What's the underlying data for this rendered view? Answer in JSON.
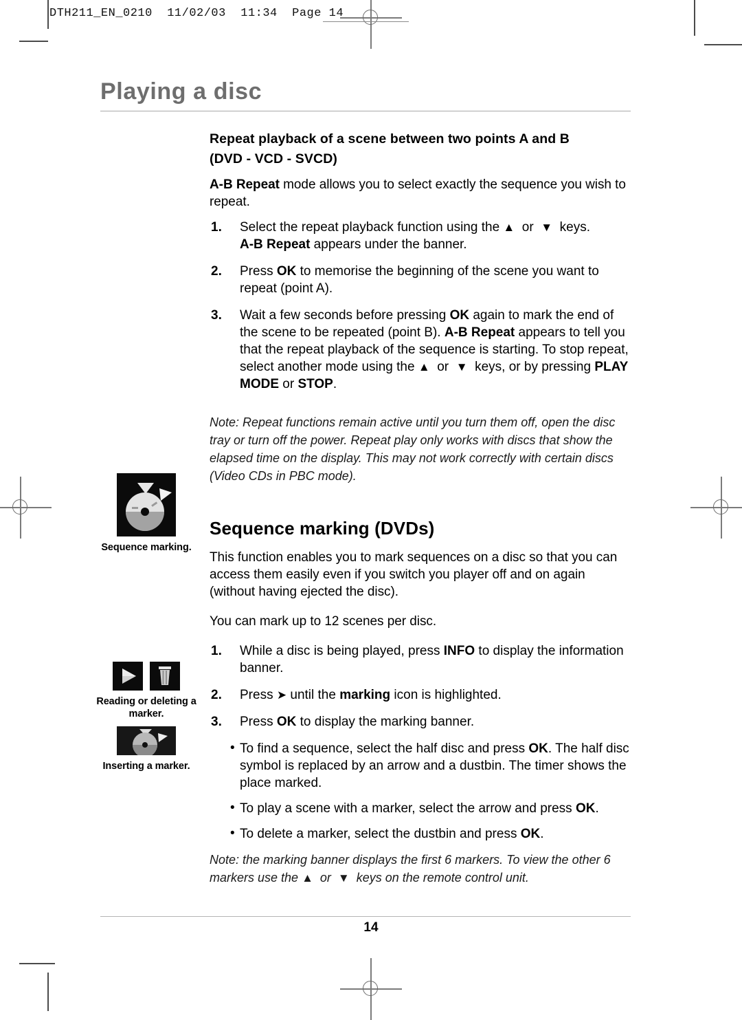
{
  "print_header": {
    "text": "DTH211_EN_0210  11/02/03  11:34  Page 14"
  },
  "page_title": "Playing a disc",
  "section_ab_repeat": {
    "heading_line1": "Repeat playback of a scene between two points A and B",
    "heading_line2": "(DVD - VCD - SVCD)",
    "intro_bold": "A-B Repeat",
    "intro_rest": " mode allows you to select exactly the sequence you wish to repeat.",
    "steps": [
      {
        "num": "1.",
        "html": "Select the repeat playback function using the <span class=\"arrow\">▲</span>&nbsp; or &nbsp;<span class=\"arrow\">▼</span>&nbsp; keys.<br><b>A-B Repeat</b> appears under the banner."
      },
      {
        "num": "2.",
        "html": "Press <b>OK</b> to memorise the beginning of the scene you want to repeat (point A)."
      },
      {
        "num": "3.",
        "html": "Wait a few seconds before pressing <b>OK</b> again to mark the end of the scene to be repeated (point B). <b>A-B Repeat</b> appears to tell you that the repeat playback of the sequence is starting. To stop repeat, select another mode using the <span class=\"arrow\">▲</span>&nbsp; or &nbsp;<span class=\"arrow\">▼</span>&nbsp; keys, or by pressing <b>PLAY MODE</b> or <b>STOP</b>."
      }
    ],
    "note": "Note: Repeat functions remain active until you turn them off, open the disc tray or turn off the power. Repeat play only works with discs that show the elapsed time on the display. This may not work correctly with certain discs (Video CDs in PBC mode)."
  },
  "section_sequence_marking": {
    "heading": "Sequence marking (DVDs)",
    "para1": "This function enables you to mark sequences on a disc so that you can access them easily even if you switch you player off and on again (without having ejected the disc).",
    "para2": "You can mark up to 12 scenes per disc.",
    "steps": [
      {
        "num": "1.",
        "html": "While a disc is being played, press <b>INFO</b> to display the information banner."
      },
      {
        "num": "2.",
        "html": "Press <span class=\"arrow\">➤</span> until the <b>marking</b> icon is highlighted."
      },
      {
        "num": "3.",
        "html": "Press <b>OK</b> to display the marking banner."
      }
    ],
    "bullets": [
      {
        "dot": "•",
        "html": "To find a sequence, select the half disc and press <b>OK</b>. The half disc symbol is replaced by an arrow and a dustbin. The timer shows the place marked."
      },
      {
        "dot": "•",
        "html": "To play a scene with a marker, select the arrow and press <b>OK</b>."
      },
      {
        "dot": "•",
        "html": "To delete a marker, select the dustbin and press <b>OK</b>."
      }
    ],
    "note_html": "Note: the marking banner displays the first 6 markers. To view the other 6 markers use the <span class=\"arrow\">▲</span>&nbsp; or &nbsp;<span class=\"arrow\">▼</span>&nbsp; keys on the remote control unit."
  },
  "figures": [
    {
      "caption": "Sequence marking.",
      "icons": [
        "disc-marking-icon"
      ]
    },
    {
      "caption": "Reading or deleting a marker.",
      "icons": [
        "play-arrow-icon",
        "dustbin-icon"
      ]
    },
    {
      "caption": "Inserting a marker.",
      "icons": [
        "half-disc-icon"
      ]
    }
  ],
  "footer": {
    "page_number": "14"
  },
  "colors": {
    "title_gray": "#6e6e6e",
    "rule_gray": "#a9a9a9",
    "icon_bg": "#0b0b0b",
    "regmark_gray": "#7a7a7a"
  }
}
